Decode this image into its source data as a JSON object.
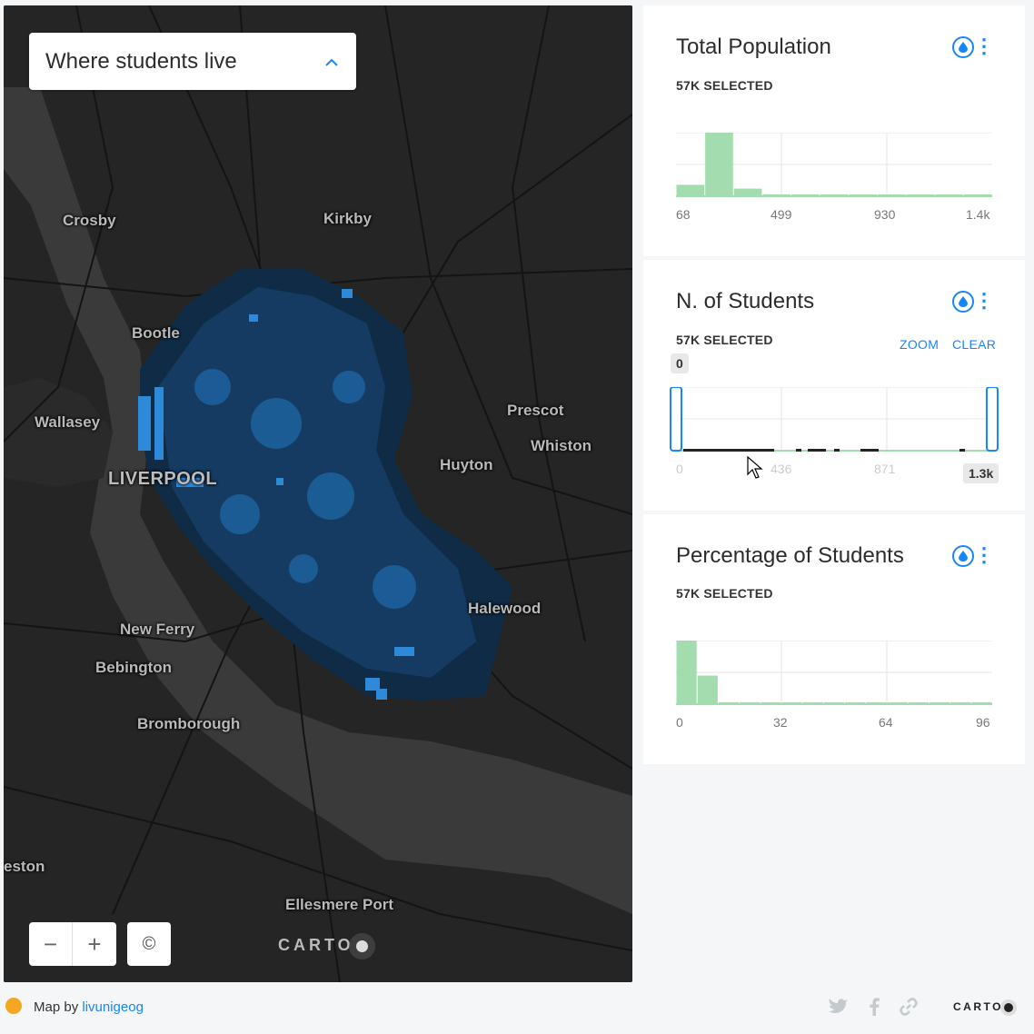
{
  "map": {
    "title": "Where students live",
    "places": [
      {
        "name": "Crosby",
        "big": false
      },
      {
        "name": "Kirkby",
        "big": false
      },
      {
        "name": "Bootle",
        "big": false
      },
      {
        "name": "Wallasey",
        "big": false
      },
      {
        "name": "Prescot",
        "big": false
      },
      {
        "name": "Whiston",
        "big": false
      },
      {
        "name": "Huyton",
        "big": false
      },
      {
        "name": "LIVERPOOL",
        "big": true
      },
      {
        "name": "Halewood",
        "big": false
      },
      {
        "name": "New Ferry",
        "big": false
      },
      {
        "name": "Bebington",
        "big": false
      },
      {
        "name": "Bromborough",
        "big": false
      },
      {
        "name": "eston",
        "big": false
      },
      {
        "name": "Ellesmere Port",
        "big": false
      }
    ],
    "zoom_out": "−",
    "zoom_in": "+",
    "attribution": "©",
    "logo": "CARTO"
  },
  "widgets": [
    {
      "title": "Total Population",
      "selected": "57K SELECTED",
      "ticks": [
        "68",
        "499",
        "930",
        "1.4k"
      ],
      "bins": [
        0.18,
        1.0,
        0.12,
        0.03,
        0.03,
        0.03,
        0.02,
        0.02,
        0.0,
        0.0,
        0.03
      ],
      "color": "#a3dcaf"
    },
    {
      "title": "N. of Students",
      "selected": "57K SELECTED",
      "zoom_label": "ZOOM",
      "clear_label": "CLEAR",
      "min_label": "0",
      "max_label": "1.3k",
      "ticks": [
        "0",
        "436",
        "871",
        "1.3k"
      ],
      "color": "#a3dcaf"
    },
    {
      "title": "Percentage of Students",
      "selected": "57K SELECTED",
      "ticks": [
        "0",
        "32",
        "64",
        "96"
      ],
      "bins": [
        1.0,
        0.45,
        0.03,
        0.03,
        0.03,
        0.03,
        0.03,
        0.03,
        0.03,
        0.03,
        0.03,
        0.03,
        0.03,
        0.03,
        0.03
      ],
      "color": "#a3dcaf"
    }
  ],
  "footer": {
    "prefix": "Map by",
    "author": "livunigeog",
    "logo": "CARTO"
  }
}
